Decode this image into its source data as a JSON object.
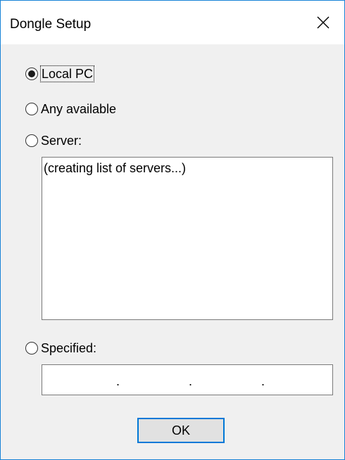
{
  "window": {
    "title": "Dongle Setup",
    "accent_color": "#1883d7"
  },
  "title_bar": {
    "close_icon": "close-icon"
  },
  "options": [
    {
      "label": "Local PC",
      "selected": true
    },
    {
      "label": "Any available",
      "selected": false
    },
    {
      "label": "Server:",
      "selected": false
    },
    {
      "label": "Specified:",
      "selected": false
    }
  ],
  "server_list": {
    "items": [
      "(creating list of servers...)"
    ]
  },
  "ip_field": {
    "separators": [
      ".",
      ".",
      "."
    ]
  },
  "buttons": {
    "ok_label": "OK"
  }
}
